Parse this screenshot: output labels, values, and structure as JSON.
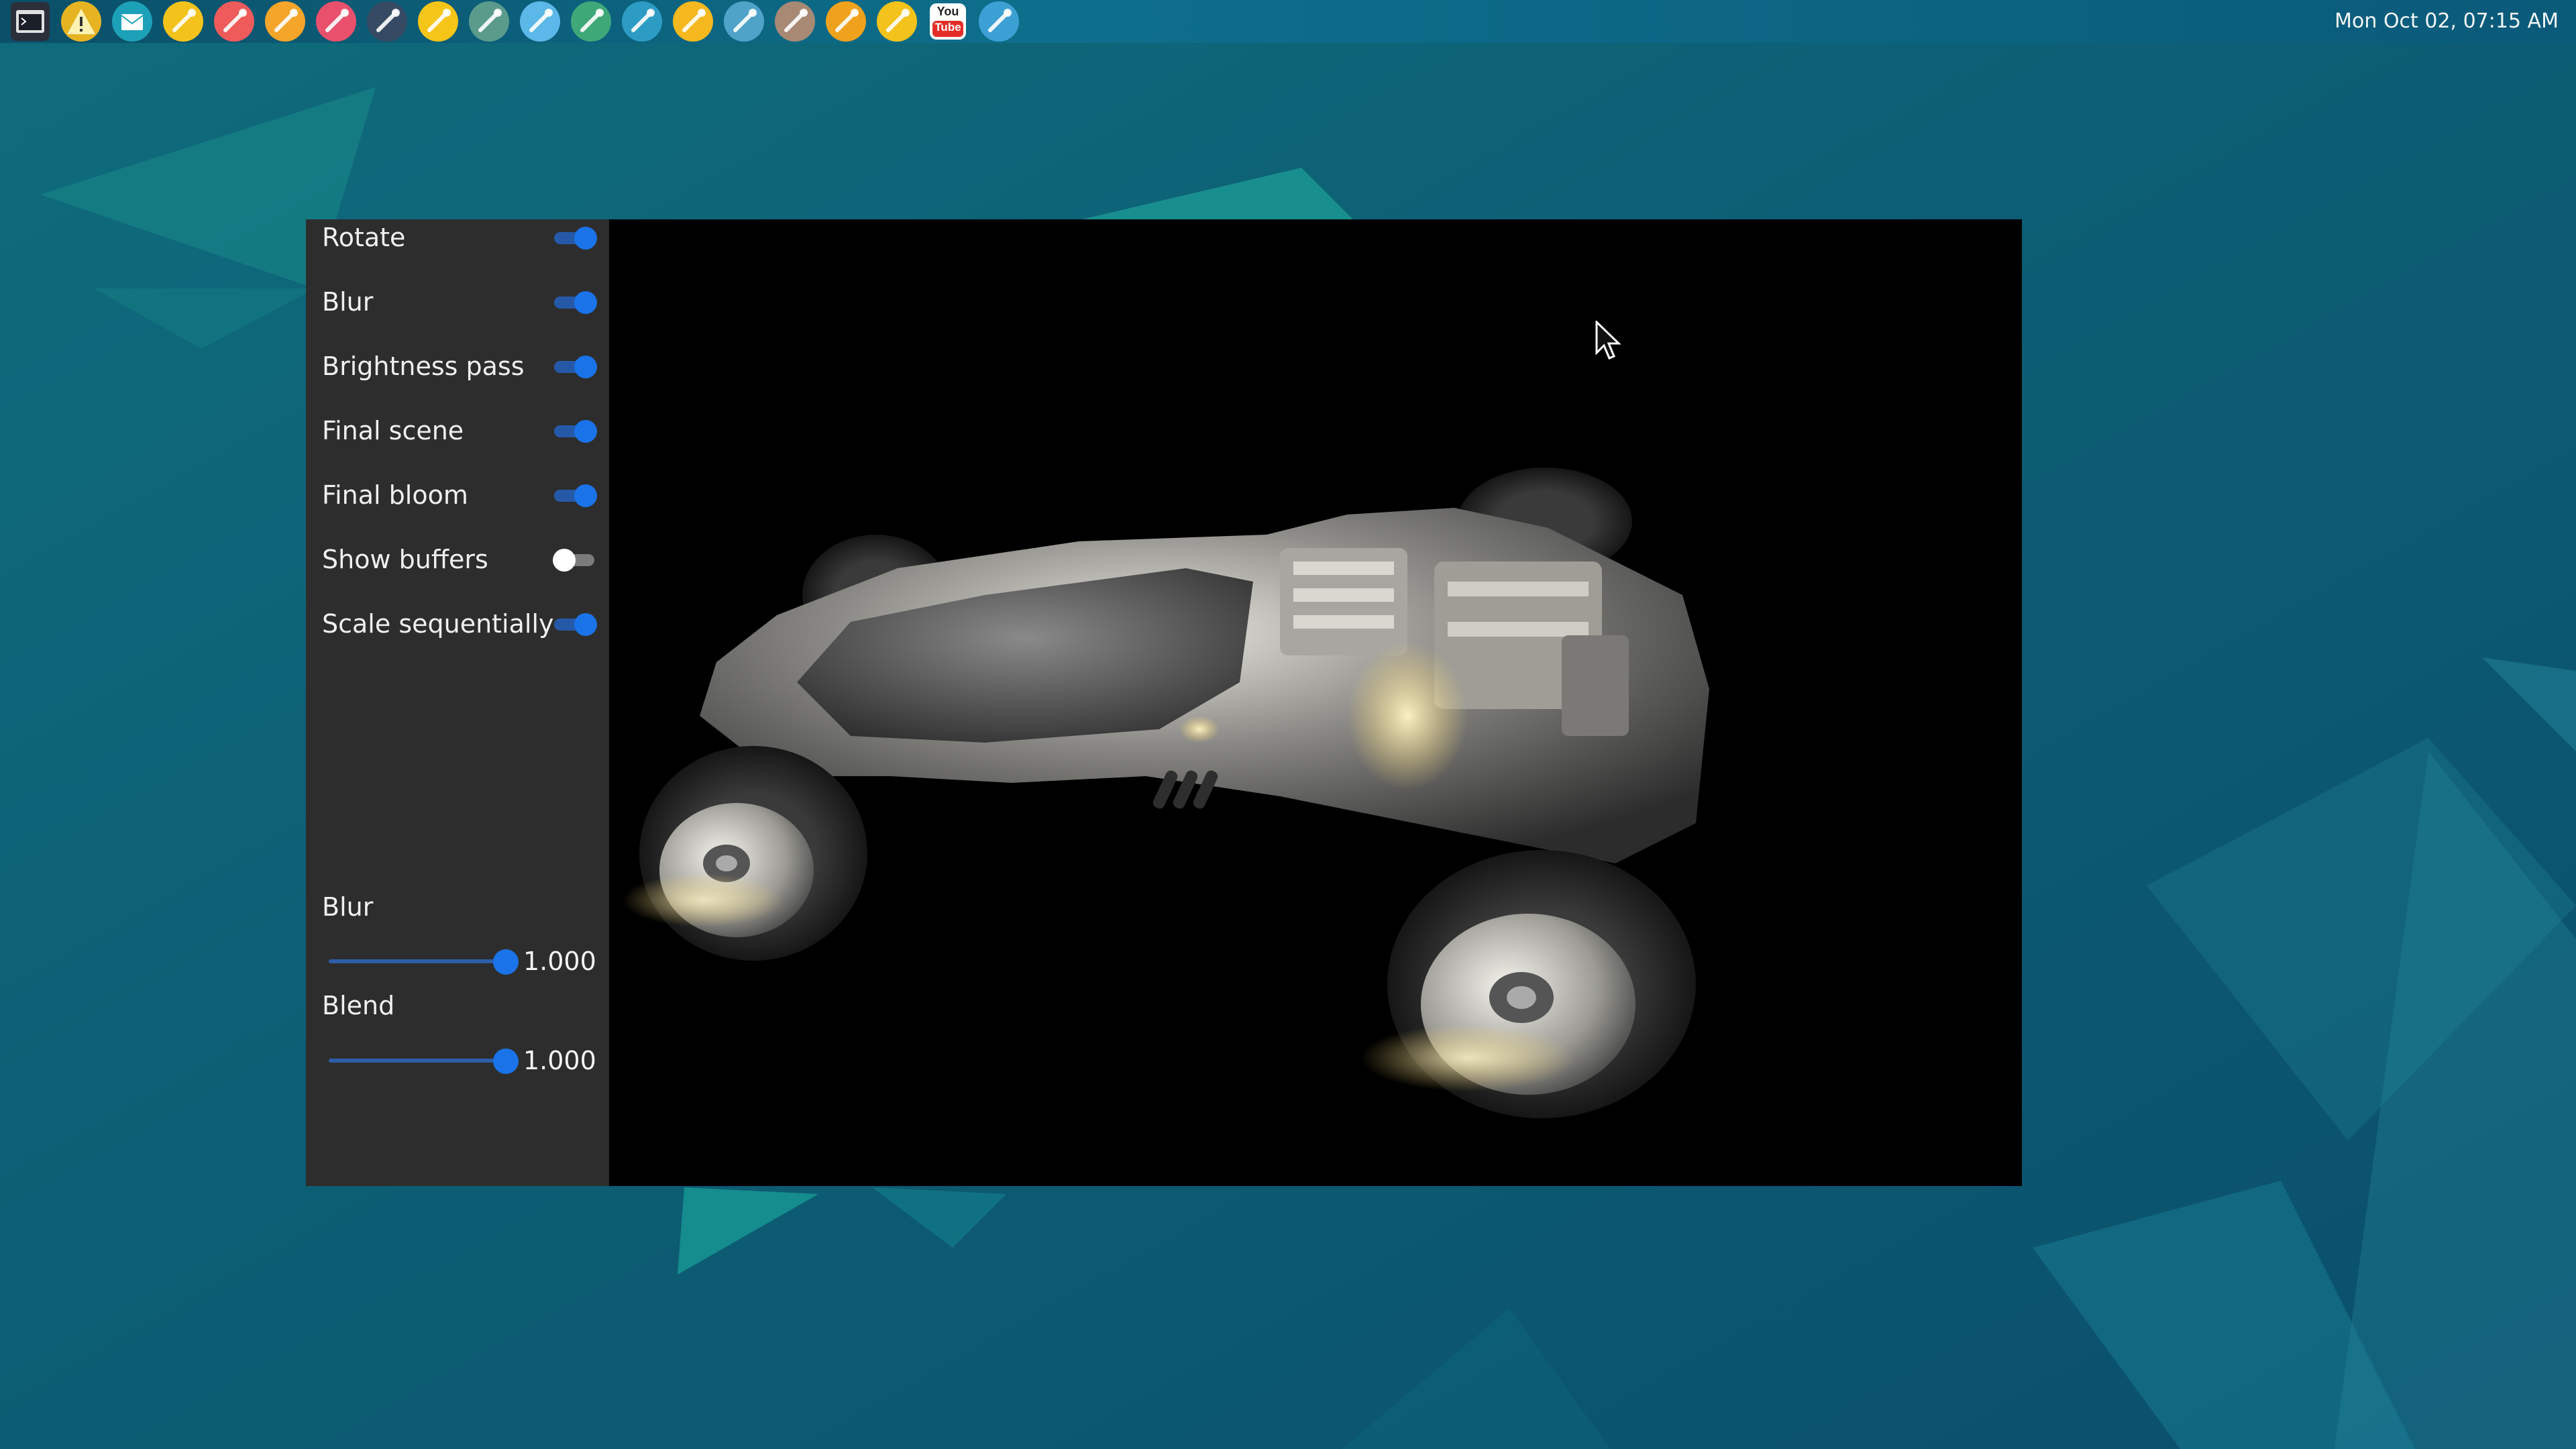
{
  "taskbar": {
    "clock": "Mon Oct 02, 07:15 AM",
    "launcher_icons": [
      {
        "name": "terminal-icon",
        "color": "#2b2f3a"
      },
      {
        "name": "warning-triangle-icon",
        "color": "#e6b422"
      },
      {
        "name": "mail-icon",
        "color": "#1da1b8"
      },
      {
        "name": "hammer-wrench-icon",
        "color": "#f3c31b"
      },
      {
        "name": "pin-icon",
        "color": "#ef5b5b"
      },
      {
        "name": "toolbox-icon",
        "color": "#f4a52a"
      },
      {
        "name": "ticket-icon",
        "color": "#e9506c"
      },
      {
        "name": "screwdriver-icon",
        "color": "#364a63"
      },
      {
        "name": "pencil-icon",
        "color": "#f5c518"
      },
      {
        "name": "gear-wrench-icon",
        "color": "#5a9b8c"
      },
      {
        "name": "ruler-icon",
        "color": "#5bb8e8"
      },
      {
        "name": "wrench-icon",
        "color": "#3fa878"
      },
      {
        "name": "brush-icon",
        "color": "#2d9cc4"
      },
      {
        "name": "marker-icon",
        "color": "#f5b81e"
      },
      {
        "name": "drill-icon",
        "color": "#4fa3c9"
      },
      {
        "name": "saw-icon",
        "color": "#a88974"
      },
      {
        "name": "briefcase-icon",
        "color": "#f0a21c"
      },
      {
        "name": "crossed-tools-icon",
        "color": "#f3c31b"
      },
      {
        "name": "youtube-icon",
        "color": "#e52d27",
        "text_top": "You",
        "text_bottom": "Tube"
      },
      {
        "name": "trowel-icon",
        "color": "#3da0d4"
      }
    ]
  },
  "controls": {
    "toggles": [
      {
        "label": "Rotate",
        "on": true
      },
      {
        "label": "Blur",
        "on": true
      },
      {
        "label": "Brightness pass",
        "on": true
      },
      {
        "label": "Final scene",
        "on": true
      },
      {
        "label": "Final bloom",
        "on": true
      },
      {
        "label": "Show buffers",
        "on": false
      },
      {
        "label": "Scale sequentially",
        "on": true
      }
    ],
    "sliders": [
      {
        "label": "Blur",
        "value_text": "1.000",
        "fraction": 1.0
      },
      {
        "label": "Blend",
        "value_text": "1.000",
        "fraction": 1.0
      }
    ]
  },
  "colors": {
    "accent": "#1a73e8",
    "panel": "#2d2d2d",
    "viewport": "#000000",
    "desktop": "#0c5a72"
  }
}
